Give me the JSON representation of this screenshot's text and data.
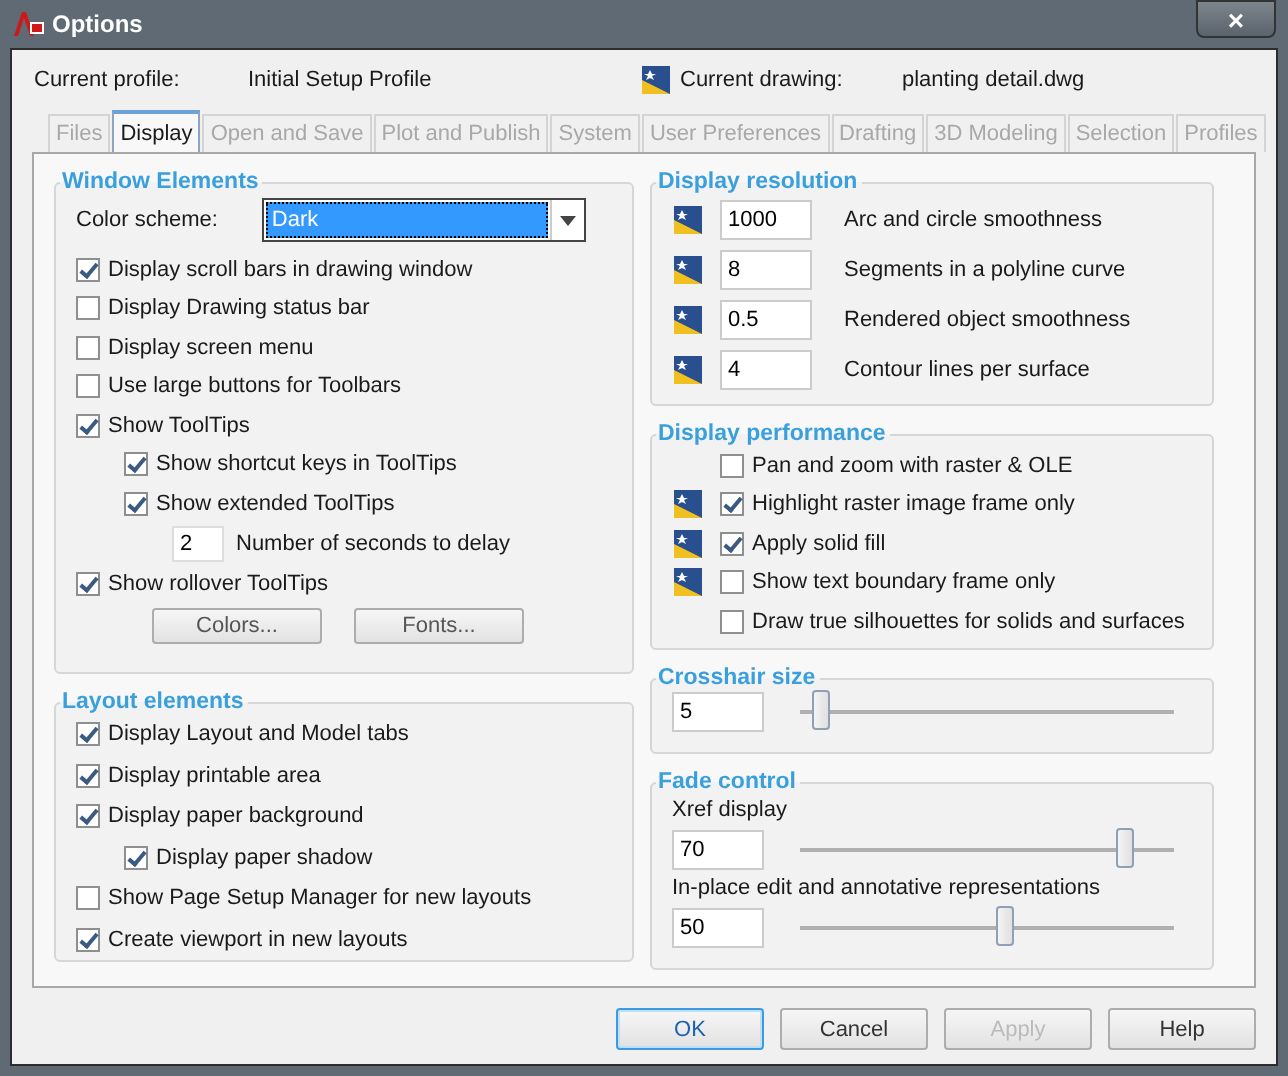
{
  "window": {
    "title": "Options",
    "close": "×"
  },
  "profile": {
    "label": "Current profile:",
    "value": "Initial Setup Profile",
    "drawing_label": "Current drawing:",
    "drawing_value": "planting detail.dwg"
  },
  "tabs": [
    {
      "label": "Files",
      "selected": false
    },
    {
      "label": "Display",
      "selected": true
    },
    {
      "label": "Open and Save",
      "selected": false
    },
    {
      "label": "Plot and Publish",
      "selected": false
    },
    {
      "label": "System",
      "selected": false
    },
    {
      "label": "User Preferences",
      "selected": false
    },
    {
      "label": "Drafting",
      "selected": false
    },
    {
      "label": "3D Modeling",
      "selected": false
    },
    {
      "label": "Selection",
      "selected": false
    },
    {
      "label": "Profiles",
      "selected": false
    }
  ],
  "window_elements": {
    "title": "Window Elements",
    "color_scheme": {
      "label": "Color scheme:",
      "value": "Dark"
    },
    "options": [
      {
        "kind": "checkbox",
        "label": "Display scroll bars in drawing window",
        "checked": true
      },
      {
        "kind": "checkbox",
        "label": "Display Drawing status bar",
        "checked": false
      },
      {
        "kind": "checkbox",
        "label": "Display screen menu",
        "checked": false
      },
      {
        "kind": "checkbox",
        "label": "Use large buttons for Toolbars",
        "checked": false
      },
      {
        "kind": "checkbox",
        "label": "Show ToolTips",
        "checked": true,
        "children": [
          {
            "kind": "checkbox",
            "label": "Show shortcut keys in ToolTips",
            "checked": true
          },
          {
            "kind": "checkbox",
            "label": "Show extended ToolTips",
            "checked": true,
            "children": [
              {
                "kind": "number",
                "value": "2",
                "label": "Number of seconds to delay"
              }
            ]
          }
        ]
      },
      {
        "kind": "checkbox",
        "label": "Show rollover ToolTips",
        "checked": true
      }
    ],
    "buttons": [
      "Colors...",
      "Fonts..."
    ]
  },
  "layout_elements": {
    "title": "Layout elements",
    "options": [
      {
        "label": "Display Layout and Model tabs",
        "checked": true
      },
      {
        "label": "Display printable area",
        "checked": true
      },
      {
        "label": "Display paper background",
        "checked": true,
        "children": [
          {
            "label": "Display paper shadow",
            "checked": true
          }
        ]
      },
      {
        "label": "Show Page Setup Manager for new layouts",
        "checked": false
      },
      {
        "label": "Create viewport in new layouts",
        "checked": true
      }
    ]
  },
  "display_resolution": {
    "title": "Display resolution",
    "rows": [
      {
        "value": "1000",
        "label": "Arc and circle smoothness",
        "saved_in_drawing": true
      },
      {
        "value": "8",
        "label": "Segments in a polyline curve",
        "saved_in_drawing": true
      },
      {
        "value": "0.5",
        "label": "Rendered object smoothness",
        "saved_in_drawing": true
      },
      {
        "value": "4",
        "label": "Contour lines per surface",
        "saved_in_drawing": true
      }
    ]
  },
  "display_performance": {
    "title": "Display performance",
    "options": [
      {
        "label": "Pan and zoom with raster & OLE",
        "checked": false,
        "saved_in_drawing": false
      },
      {
        "label": "Highlight raster image frame only",
        "checked": true,
        "saved_in_drawing": true
      },
      {
        "label": "Apply solid fill",
        "checked": true,
        "saved_in_drawing": true
      },
      {
        "label": "Show text boundary frame only",
        "checked": false,
        "saved_in_drawing": true
      },
      {
        "label": "Draw true silhouettes for solids and surfaces",
        "checked": false,
        "saved_in_drawing": false
      }
    ]
  },
  "crosshair": {
    "title": "Crosshair size",
    "value": "5",
    "level": 0.06
  },
  "fade_control": {
    "title": "Fade control",
    "rows": [
      {
        "label": "Xref display",
        "value": "70",
        "level": 0.87
      },
      {
        "label": "In-place edit and annotative representations",
        "value": "50",
        "level": 0.55
      }
    ]
  },
  "buttons": [
    {
      "label": "OK",
      "kind": "default",
      "disabled": false
    },
    {
      "label": "Cancel",
      "kind": "normal",
      "disabled": false
    },
    {
      "label": "Apply",
      "kind": "normal",
      "disabled": true
    },
    {
      "label": "Help",
      "kind": "normal",
      "disabled": false
    }
  ]
}
